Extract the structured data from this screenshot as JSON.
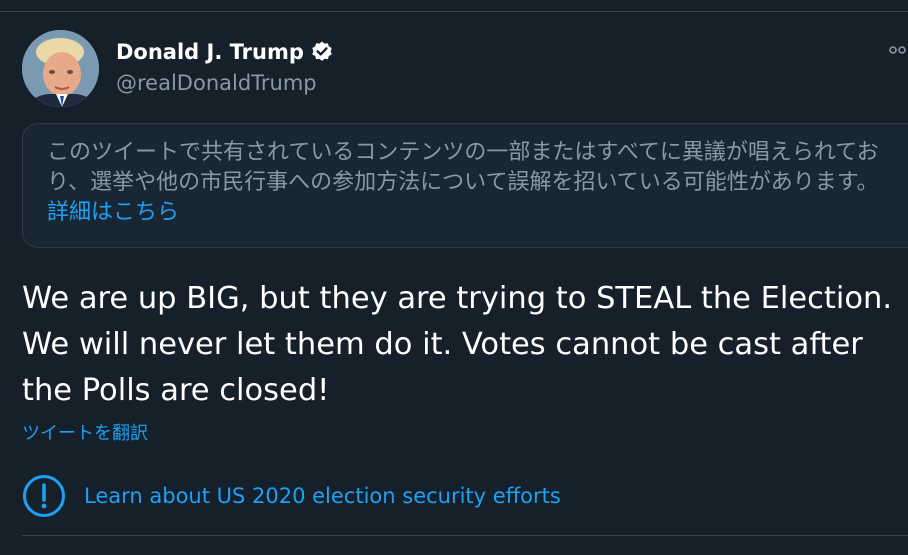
{
  "author": {
    "name": "Donald J. Trump",
    "handle": "@realDonaldTrump",
    "verified": true
  },
  "notice": {
    "text": "このツイートで共有されているコンテンツの一部またはすべてに異議が唱えられており、選挙や他の市民行事への参加方法について誤解を招いている可能性があります。",
    "link_label": "詳細はこちら"
  },
  "tweet": {
    "text": "We are up BIG, but they are trying to STEAL the Election. We will never let them do it. Votes cannot be cast after the Polls are closed!",
    "translate_label": "ツイートを翻訳"
  },
  "election_prompt": {
    "label": "Learn about US 2020 election security efforts",
    "icon": "alert-circle-icon"
  },
  "icons": {
    "verified": "verified-badge-icon",
    "more": "more-icon"
  },
  "colors": {
    "background": "#15202b",
    "card": "#192734",
    "accent": "#1da1f2",
    "secondary_text": "#8899a6",
    "divider": "#38444d"
  }
}
